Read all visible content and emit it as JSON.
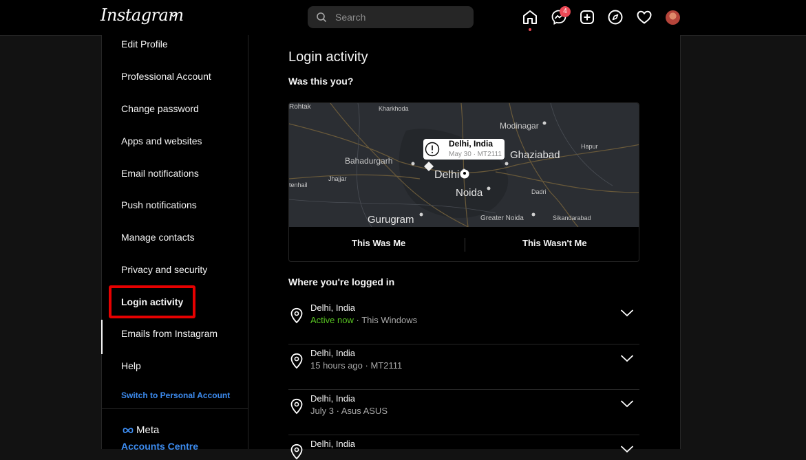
{
  "header": {
    "logo": "Instagram",
    "search_placeholder": "Search",
    "messages_badge": "4"
  },
  "sidebar": {
    "items": [
      {
        "label": "Edit Profile"
      },
      {
        "label": "Professional Account"
      },
      {
        "label": "Change password"
      },
      {
        "label": "Apps and websites"
      },
      {
        "label": "Email notifications"
      },
      {
        "label": "Push notifications"
      },
      {
        "label": "Manage contacts"
      },
      {
        "label": "Privacy and security"
      },
      {
        "label": "Login activity"
      },
      {
        "label": "Emails from Instagram"
      },
      {
        "label": "Help"
      }
    ],
    "switch_label": "Switch to Personal Account",
    "meta_label": "Meta",
    "accounts_label": "Accounts Centre"
  },
  "main": {
    "title": "Login activity",
    "prompt": "Was this you?",
    "map": {
      "labels": [
        "Rohtak",
        "Kharkhoda",
        "Modinagar",
        "Bahadurgarh",
        "Jhajjar",
        "tenhail",
        "Hapur",
        "Dadri",
        "Greater Noida",
        "Sikandarabad"
      ],
      "cities": [
        "Ghaziabad",
        "Delhi",
        "Noida",
        "Gurugram"
      ]
    },
    "tooltip": {
      "location": "Delhi, India",
      "details": "May 30 · MT2111"
    },
    "confirm_label": "This Was Me",
    "deny_label": "This Wasn't Me",
    "sessions_title": "Where you're logged in",
    "sessions": [
      {
        "location": "Delhi, India",
        "status": "Active now",
        "device": " · This Windows"
      },
      {
        "location": "Delhi, India",
        "details": "15 hours ago · MT2111"
      },
      {
        "location": "Delhi, India",
        "details": "July 3 · Asus ASUS"
      },
      {
        "location": "Delhi, India",
        "details": ""
      }
    ]
  },
  "colors": {
    "accent_blue": "#3d8cf0",
    "active_green": "#58c322",
    "badge_red": "#ed4956",
    "highlight_red": "#e60000"
  }
}
